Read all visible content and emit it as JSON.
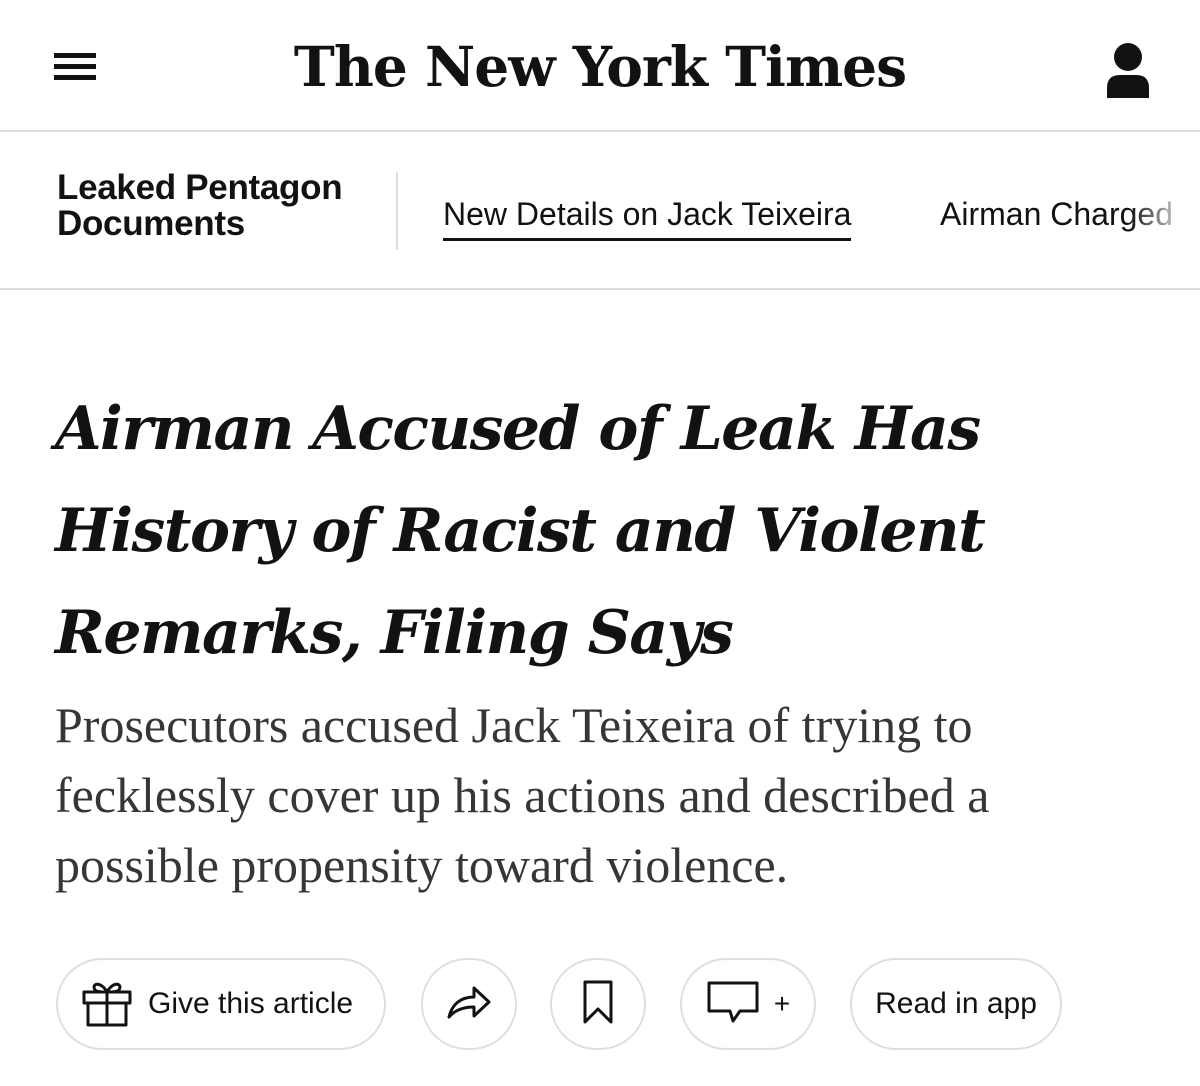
{
  "masthead": {
    "logo_text": "The New York Times",
    "menu_icon": "hamburger-menu-icon",
    "account_icon": "account-icon"
  },
  "subnav": {
    "section_title": "Leaked Pentagon Documents",
    "links": [
      {
        "label": "New Details on Jack Teixeira",
        "active": true
      },
      {
        "label": "Airman Charged",
        "active": false
      }
    ]
  },
  "article": {
    "headline": "Airman Accused of Leak Has History of Racist and Violent Remarks, Filing Says",
    "summary": "Prosecutors accused Jack Teixeira of trying to fecklessly cover up his actions and described a possible propensity toward violence."
  },
  "actions": {
    "gift_label": "Give this article",
    "gift_icon": "gift-icon",
    "share_icon": "share-icon",
    "save_icon": "bookmark-icon",
    "comment_icon": "comment-icon",
    "comment_plus": "+",
    "read_in_app_label": "Read in app"
  },
  "colors": {
    "text": "#121212",
    "summary_text": "#363636",
    "rule": "#dcdcdc",
    "pill_border": "#dfdfdf"
  }
}
